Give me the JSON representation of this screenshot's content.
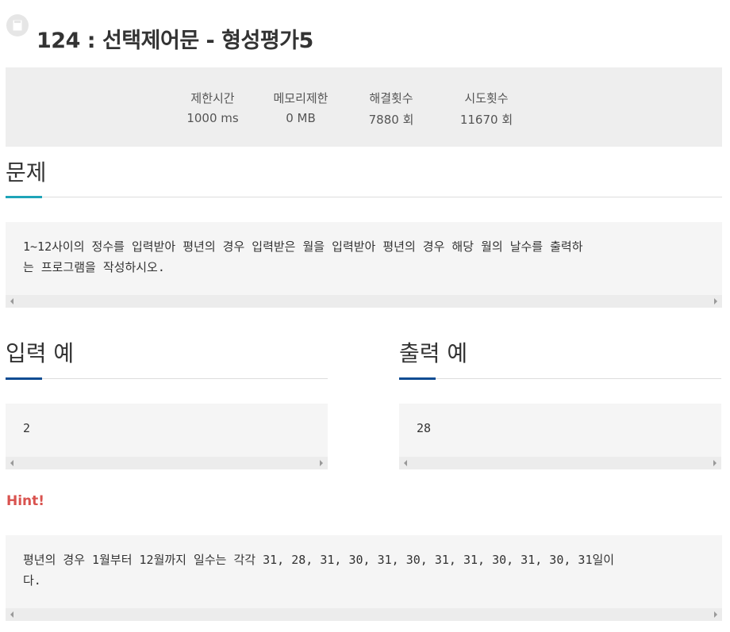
{
  "title": "124 : 선택제어문 - 형성평가5",
  "icons": {
    "title_icon": "document-icon"
  },
  "stats": [
    {
      "label": "제한시간",
      "value": "1000 ms"
    },
    {
      "label": "메모리제한",
      "value": "0 MB"
    },
    {
      "label": "해결횟수",
      "value": "7880 회"
    },
    {
      "label": "시도횟수",
      "value": "11670 회"
    }
  ],
  "problem": {
    "heading": "문제",
    "text": "1~12사이의 정수를 입력받아 평년의 경우 입력받은 월을 입력받아 평년의 경우 해당 월의 날수를 출력하\n는 프로그램을 작성하시오."
  },
  "input_example": {
    "heading": "입력 예",
    "text": "2"
  },
  "output_example": {
    "heading": "출력 예",
    "text": "28"
  },
  "hint": {
    "label": "Hint!",
    "text": "평년의 경우 1월부터 12월까지 일수는 각각 31, 28, 31, 30, 31, 30, 31, 31, 30, 31, 30, 31일이\n다."
  },
  "colors": {
    "problem_accent": "#1ea4b8",
    "example_accent": "#0e4c92",
    "hint": "#d9534f",
    "stats_bg": "#eeeeee",
    "box_bg": "#f5f5f5"
  }
}
